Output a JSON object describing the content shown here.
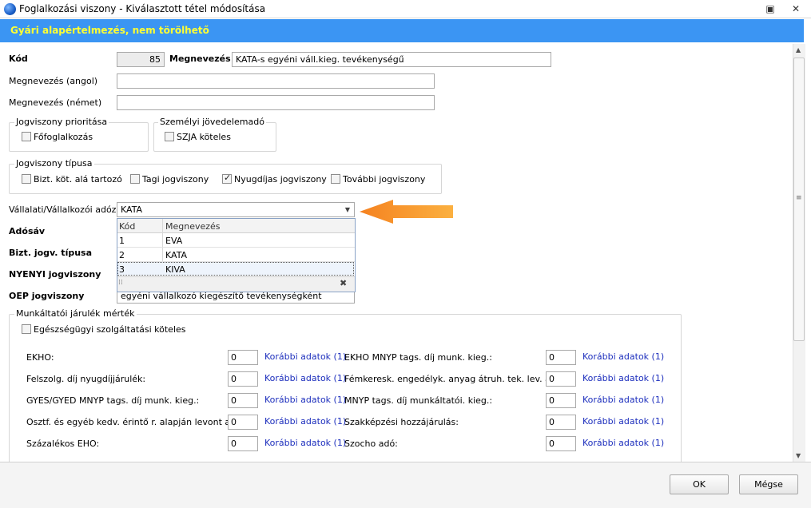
{
  "window": {
    "title": "Foglalkozási viszony - Kiválasztott tétel módosítása",
    "banner": "Gyári alapértelmezés, nem törölhető"
  },
  "form": {
    "kod_label": "Kód",
    "kod_value": "85",
    "megnevezes_label": "Megnevezés",
    "megnevezes_value": "KATA-s egyéni váll.kieg. tevékenységű",
    "angol_label": "Megnevezés (angol)",
    "angol_value": "",
    "nemet_label": "Megnevezés (német)",
    "nemet_value": "",
    "prioritas_group": "Jogviszony prioritása",
    "foglalkozas_label": "Főfoglalkozás",
    "szja_group": "Személyi jövedelemadó",
    "szja_label": "SZJA köteles",
    "tipus_group": "Jogviszony típusa",
    "tipus_options": [
      {
        "label": "Bizt. köt. alá tartozó",
        "checked": false
      },
      {
        "label": "Tagi jogviszony",
        "checked": false
      },
      {
        "label": "Nyugdíjas jogviszony",
        "checked": true
      },
      {
        "label": "További jogviszony",
        "checked": false
      }
    ],
    "adozas_label": "Vállalati/Vállalkozói adózás",
    "adozas_value": "KATA",
    "adosav_label": "Adósáv",
    "bizt_label": "Bizt. jogv. típusa",
    "nyenyi_label": "NYENYI jogviszony",
    "oep_label": "OEP jogviszony",
    "oep_value": "egyéni vállalkozó kiegészítő tevékenységként"
  },
  "dropdown": {
    "col_kod": "Kód",
    "col_megnevezes": "Megnevezés",
    "rows": [
      {
        "kod": "1",
        "megnevezes": "EVA"
      },
      {
        "kod": "2",
        "megnevezes": "KATA"
      },
      {
        "kod": "3",
        "megnevezes": "KIVA"
      }
    ]
  },
  "jarulek": {
    "group": "Munkáltatói járulék mérték",
    "egeszseg_label": "Egészségügyi szolgáltatási köteles",
    "link_text": "Korábbi adatok (1)",
    "left": [
      {
        "label": "EKHO:",
        "value": "0",
        "link": true
      },
      {
        "label": "Felszolg. díj nyugdíjjárulék:",
        "value": "0",
        "link": true
      },
      {
        "label": "GYES/GYED MNYP tags. díj munk. kieg.:",
        "value": "0",
        "link": true
      },
      {
        "label": "Osztf. és egyéb kedv. érintő r. alapján levont adó:",
        "value": "0",
        "link": true
      },
      {
        "label": "Százalékos EHO:",
        "value": "0",
        "link": true
      }
    ],
    "right": [
      {
        "label": "EKHO MNYP tags. díj munk. kieg.:",
        "value": "0",
        "link": true
      },
      {
        "label": "Fémkeresk. engedélyk. anyag átruh. tek. lev. adó:",
        "value": "0",
        "link": true
      },
      {
        "label": "MNYP tags. díj munkáltatói. kieg.:",
        "value": "0",
        "link": true
      },
      {
        "label": "Szakképzési hozzájárulás:",
        "value": "0",
        "link": true
      },
      {
        "label": "Szocho adó:",
        "value": "0",
        "link": true
      }
    ]
  },
  "footer": {
    "ok_label": "OK",
    "cancel_label": "Mégse"
  },
  "colors": {
    "banner_bg": "#3b95f3",
    "banner_text": "#ffff33",
    "link": "#1d2fbd",
    "arrow": "#f7941d"
  }
}
